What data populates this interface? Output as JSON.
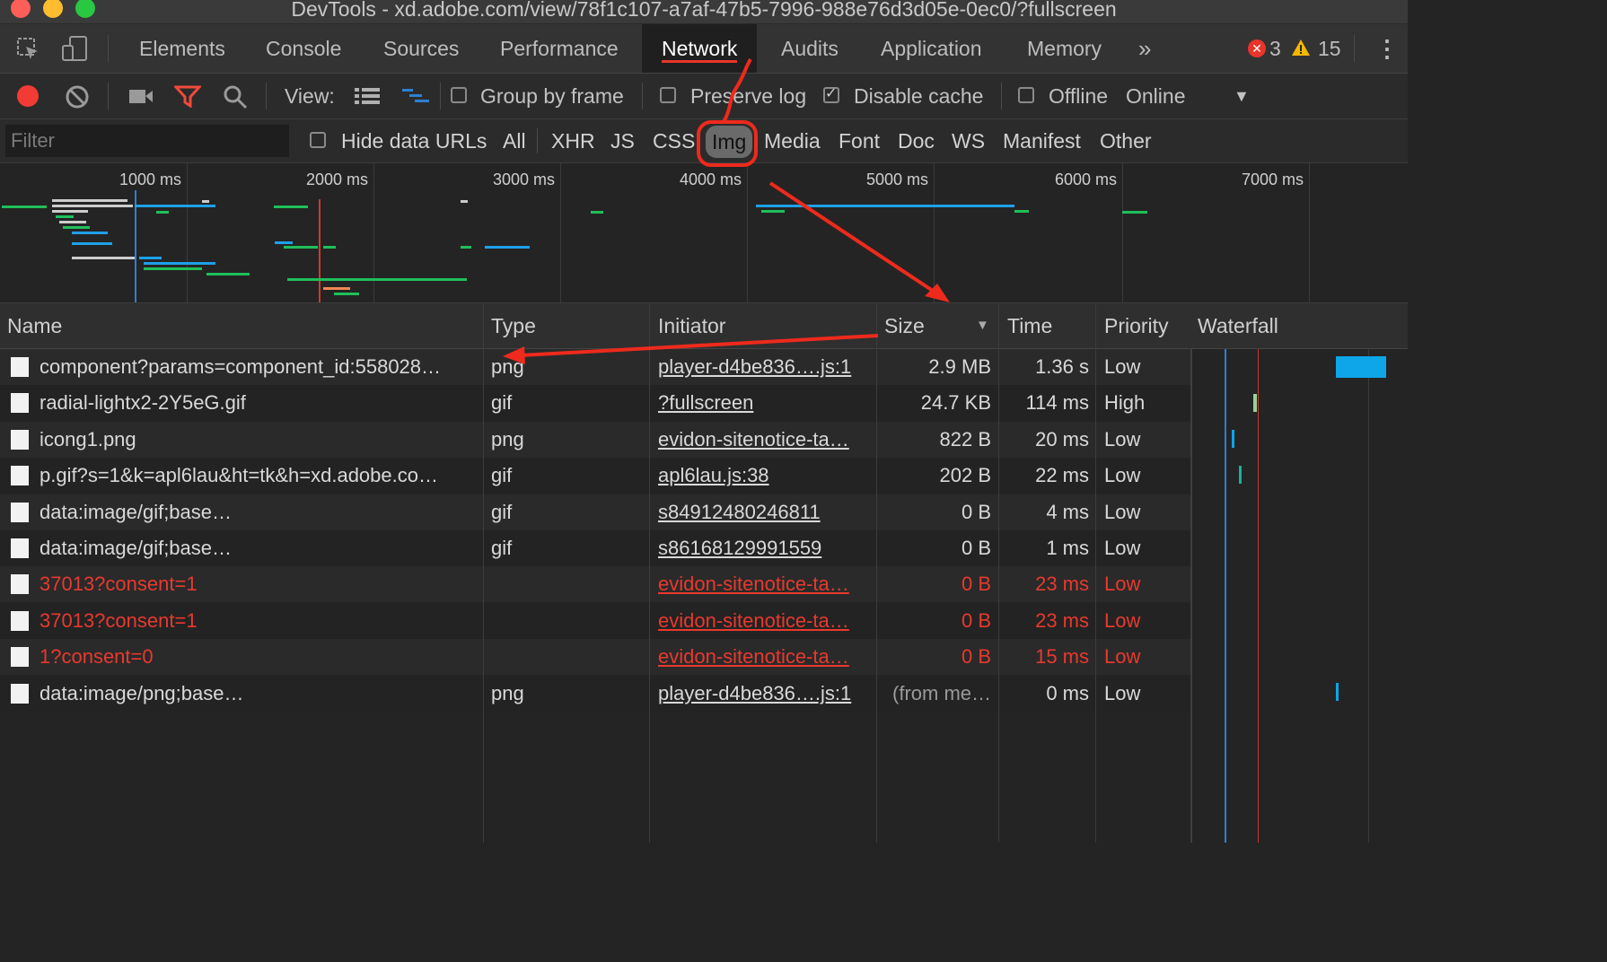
{
  "window": {
    "title": "DevTools - xd.adobe.com/view/78f1c107-a7af-47b5-7996-988e76d3d05e-0ec0/?fullscreen"
  },
  "tabs": [
    "Elements",
    "Console",
    "Sources",
    "Performance",
    "Network",
    "Audits",
    "Application",
    "Memory"
  ],
  "active_tab": "Network",
  "more_tabs_glyph": "»",
  "status": {
    "errors": "3",
    "warnings": "15"
  },
  "toolbar": {
    "view_label": "View:",
    "group_by_frame": "Group by frame",
    "preserve_log": "Preserve log",
    "disable_cache": "Disable cache",
    "disable_cache_checked": true,
    "offline": "Offline",
    "throttling": "Online"
  },
  "filter": {
    "placeholder": "Filter",
    "hide_data_urls": "Hide data URLs",
    "types": [
      "All",
      "XHR",
      "JS",
      "CSS",
      "Img",
      "Media",
      "Font",
      "Doc",
      "WS",
      "Manifest",
      "Other"
    ],
    "selected": "Img"
  },
  "overview": {
    "ticks": [
      "1000 ms",
      "2000 ms",
      "3000 ms",
      "4000 ms",
      "5000 ms",
      "6000 ms",
      "7000 ms"
    ]
  },
  "columns": {
    "name": "Name",
    "type": "Type",
    "initiator": "Initiator",
    "size": "Size",
    "time": "Time",
    "priority": "Priority",
    "waterfall": "Waterfall"
  },
  "rows": [
    {
      "name": "component?params=component_id:558028…",
      "type": "png",
      "initiator": "player-d4be836….js:1",
      "size": "2.9 MB",
      "time": "1.36 s",
      "priority": "Low",
      "error": false
    },
    {
      "name": "radial-lightx2-2Y5eG.gif",
      "type": "gif",
      "initiator": "?fullscreen",
      "size": "24.7 KB",
      "time": "114 ms",
      "priority": "High",
      "error": false
    },
    {
      "name": "icong1.png",
      "type": "png",
      "initiator": "evidon-sitenotice-ta…",
      "size": "822 B",
      "time": "20 ms",
      "priority": "Low",
      "error": false
    },
    {
      "name": "p.gif?s=1&k=apl6lau&ht=tk&h=xd.adobe.co…",
      "type": "gif",
      "initiator": "apl6lau.js:38",
      "size": "202 B",
      "time": "22 ms",
      "priority": "Low",
      "error": false
    },
    {
      "name": "data:image/gif;base…",
      "type": "gif",
      "initiator": "s84912480246811",
      "size": "0 B",
      "time": "4 ms",
      "priority": "Low",
      "error": false
    },
    {
      "name": "data:image/gif;base…",
      "type": "gif",
      "initiator": "s86168129991559",
      "size": "0 B",
      "time": "1 ms",
      "priority": "Low",
      "error": false
    },
    {
      "name": "37013?consent=1",
      "type": "",
      "initiator": "evidon-sitenotice-ta…",
      "size": "0 B",
      "time": "23 ms",
      "priority": "Low",
      "error": true
    },
    {
      "name": "37013?consent=1",
      "type": "",
      "initiator": "evidon-sitenotice-ta…",
      "size": "0 B",
      "time": "23 ms",
      "priority": "Low",
      "error": true
    },
    {
      "name": "1?consent=0",
      "type": "",
      "initiator": "evidon-sitenotice-ta…",
      "size": "0 B",
      "time": "15 ms",
      "priority": "Low",
      "error": true
    },
    {
      "name": "data:image/png;base…",
      "type": "png",
      "initiator": "player-d4be836….js:1",
      "size": "(from me…",
      "time": "0 ms",
      "priority": "Low",
      "error": false
    }
  ],
  "colors": {
    "accent_red": "#e8352b",
    "waterfall_blue": "#0ea5e9",
    "error_text": "#e8392e"
  }
}
